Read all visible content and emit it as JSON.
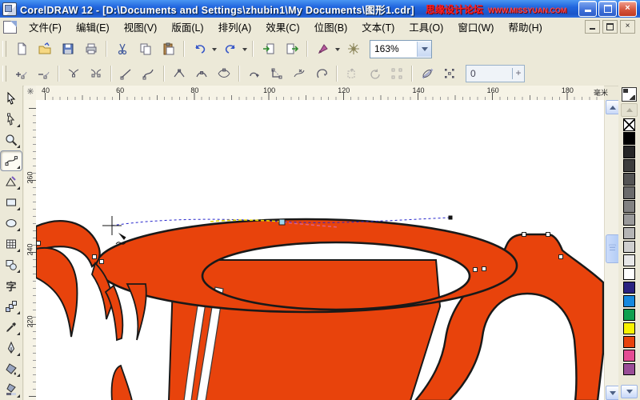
{
  "window": {
    "title": "CorelDRAW 12 - [D:\\Documents and Settings\\zhubin1\\My Documents\\图形1.cdr]",
    "watermark_text": "思缘设计论坛",
    "watermark_site": "WWW.MISSYUAN.COM"
  },
  "menu": {
    "items": [
      {
        "label": "文件(F)"
      },
      {
        "label": "编辑(E)"
      },
      {
        "label": "视图(V)"
      },
      {
        "label": "版面(L)"
      },
      {
        "label": "排列(A)"
      },
      {
        "label": "效果(C)"
      },
      {
        "label": "位图(B)"
      },
      {
        "label": "文本(T)"
      },
      {
        "label": "工具(O)"
      },
      {
        "label": "窗口(W)"
      },
      {
        "label": "帮助(H)"
      }
    ]
  },
  "standard_toolbar": {
    "zoom_value": "163%",
    "buttons": [
      "new-document",
      "open",
      "save",
      "print",
      "cut",
      "copy",
      "paste",
      "undo",
      "redo",
      "import",
      "export",
      "application-launcher",
      "corel-online"
    ]
  },
  "property_bar": {
    "smoothness_value": "0",
    "buttons": [
      "add-node",
      "delete-node",
      "join-two-nodes",
      "break-curve",
      "convert-curve-to-line",
      "convert-line-to-curve",
      "make-node-cusp",
      "make-node-smooth",
      "make-node-symmetrical",
      "reverse-curve-direction",
      "close-curve",
      "extract-subpath",
      "auto-close-curve",
      "stretch-scale-nodes",
      "rotate-skew-nodes",
      "align-nodes",
      "elastic-mode",
      "select-all-nodes"
    ]
  },
  "rulers": {
    "unit_label": "毫米",
    "h_numbers": [
      "40",
      "60",
      "80",
      "100",
      "120",
      "140",
      "160",
      "180"
    ],
    "v_numbers": [
      "260",
      "240",
      "220"
    ]
  },
  "toolbox": {
    "text_tool_glyph": "字",
    "tools": [
      "pick",
      "shape",
      "zoom",
      "freehand",
      "smart-drawing",
      "rectangle",
      "ellipse",
      "graph-paper",
      "basic-shapes",
      "text",
      "interactive-blend",
      "eyedropper",
      "outline",
      "fill",
      "interactive-fill"
    ]
  },
  "palette": {
    "swatches": [
      "#000000",
      "#262626",
      "#3D3D3D",
      "#545454",
      "#6B6B6B",
      "#828282",
      "#9A9A9A",
      "#B5B5B5",
      "#CFCFCF",
      "#E8E8E8",
      "#FFFFFF",
      "#2B2380",
      "#1789DE",
      "#0FA04E",
      "#F8F200",
      "#E8430C",
      "#E44D93",
      "#9A4E97"
    ]
  },
  "canvas": {
    "artwork_fill": "#E8430C",
    "artwork_outline": "#191919",
    "selection_line_color": "#2424CC"
  }
}
